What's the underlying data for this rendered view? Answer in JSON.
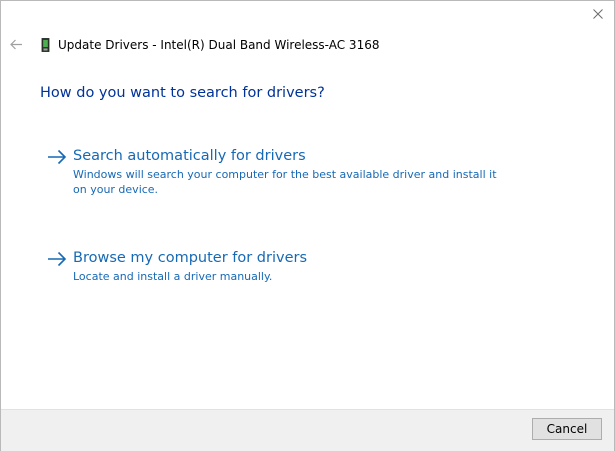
{
  "window": {
    "title": "Update Drivers - Intel(R) Dual Band Wireless-AC 3168"
  },
  "icons": {
    "close": "close-icon",
    "back": "back-arrow-icon",
    "device": "network-adapter-icon",
    "option_arrow": "right-arrow-icon"
  },
  "main": {
    "heading": "How do you want to search for drivers?",
    "options": [
      {
        "title": "Search automatically for drivers",
        "description": "Windows will search your computer for the best available driver and install it on your device."
      },
      {
        "title": "Browse my computer for drivers",
        "description": "Locate and install a driver manually."
      }
    ]
  },
  "footer": {
    "cancel_label": "Cancel"
  },
  "colors": {
    "heading": "#003399",
    "link": "#1769b5",
    "footer_bg": "#f0f0f0"
  }
}
